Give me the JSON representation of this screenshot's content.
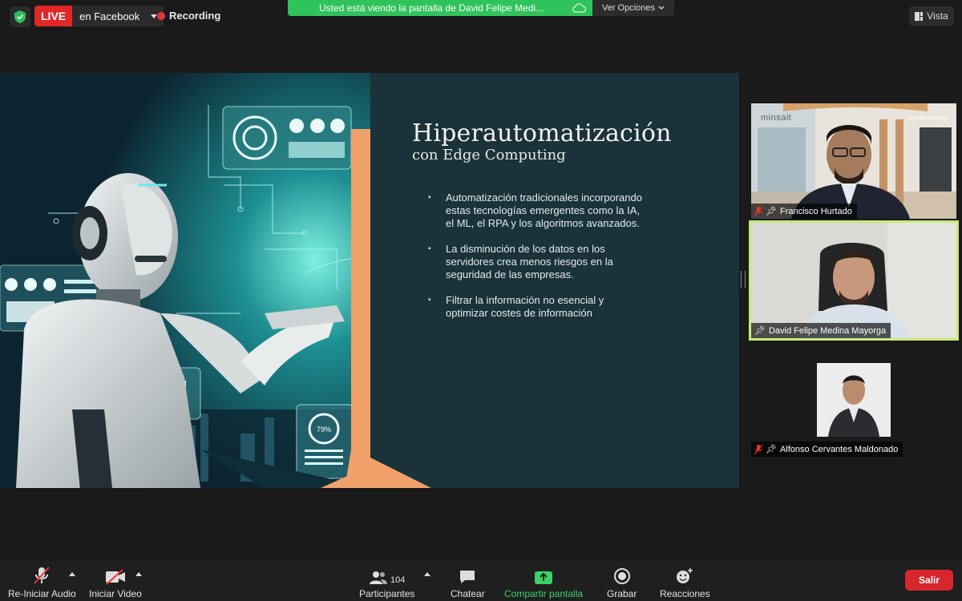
{
  "topbar": {
    "live_label": "LIVE",
    "live_destination": "en Facebook",
    "recording_label": "Recording",
    "share_banner": "Usted está viendo la pantalla de David Felipe Medi...",
    "view_options": "Ver Opciones",
    "view_button": "Vista"
  },
  "slide": {
    "title": "Hiperautomatización",
    "subtitle": "con Edge Computing",
    "bullets": [
      "Automatización tradicionales incorporando estas tecnologías emergentes como la IA, el ML, el RPA y los algoritmos avanzados.",
      "La disminución de los datos en los servidores crea menos riesgos en la seguridad de las empresas.",
      "Filtrar la información no esencial y optimizar costes de información"
    ],
    "art_text": {
      "logo_text": "minsait",
      "gauge_text": "79%"
    }
  },
  "participants": [
    {
      "name": "Francisco Hurtado",
      "muted": true,
      "speaking": false,
      "background_caption": "An Indra company"
    },
    {
      "name": "David Felipe Medina Mayorga",
      "muted": false,
      "speaking": true
    },
    {
      "name": "Alfonso Cervantes Maldonado",
      "muted": true,
      "speaking": false
    }
  ],
  "toolbar": {
    "audio": "Re-Iniciar Audio",
    "video": "Iniciar Video",
    "participants": "Participantes",
    "participants_count": "104",
    "chat": "Chatear",
    "share": "Compartir pantalla",
    "record": "Grabar",
    "reactions": "Reacciones",
    "leave": "Salir"
  },
  "colors": {
    "live_red": "#e02828",
    "share_green": "#2fc35b",
    "speaking_outline": "#c9e97a",
    "leave_red": "#d7262e",
    "slide_bg": "#1a3239",
    "accent_orange": "#f0a16a"
  }
}
